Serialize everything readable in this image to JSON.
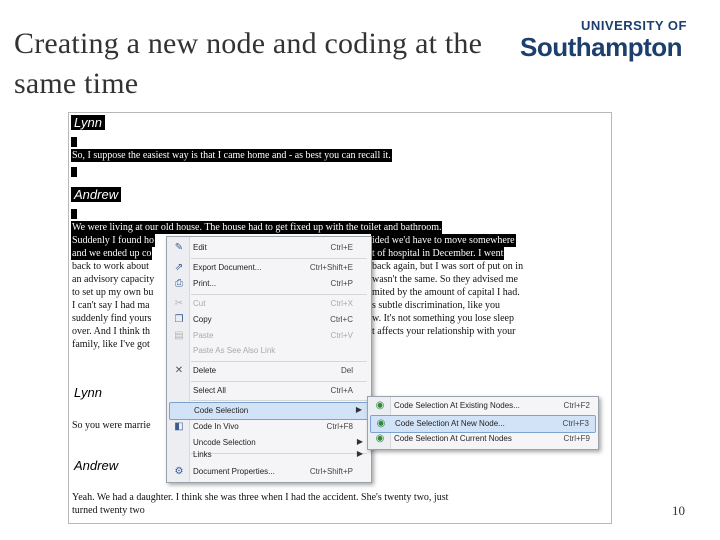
{
  "slide": {
    "title": "Creating a new node and coding at the same time",
    "logo_top": "UNIVERSITY OF",
    "logo_main": "Southampton",
    "page_number": "10"
  },
  "transcript": {
    "blocks": [
      {
        "speaker": "Lynn",
        "lines": [
          "So, I suppose the easiest way is that I came home and - as best you can recall it."
        ]
      },
      {
        "speaker": "Andrew",
        "lines": [
          "We were living at our old house. The house had to get fixed up with the toilet and bathroom.",
          "Suddenly I found ho",
          "and we ended up co",
          "back to work about",
          "an advisory capacity",
          "to set up my own bu",
          "I can't say I had ma",
          "suddenly find yours",
          "over. And I think th",
          "family, like I've got"
        ],
        "line_tails": [
          "",
          "ided we'd have to move somewhere",
          "t of hospital in December. I went",
          "back again, but I was sort of put on in",
          "wasn't the same. So they advised me",
          "mited by the amount of capital I had.",
          "s subtle discrimination, like you",
          "w. It's not something you lose sleep",
          "t affects your relationship with your",
          ""
        ]
      },
      {
        "speaker": "Lynn",
        "lines": [
          "So you were marrie"
        ]
      },
      {
        "speaker": "Andrew",
        "lines": [
          "Yeah. We had a daughter. I think she was three when I had the accident. She's twenty two, just",
          "turned twenty two"
        ]
      }
    ]
  },
  "context_menu": {
    "items": [
      {
        "label": "Edit",
        "shortcut": "Ctrl+E",
        "icon": "pencil-icon",
        "glyph": "✎",
        "enabled": true
      },
      {
        "label": "Export Document...",
        "shortcut": "Ctrl+Shift+E",
        "icon": "export-icon",
        "glyph": "⇗",
        "enabled": true
      },
      {
        "label": "Print...",
        "shortcut": "Ctrl+P",
        "icon": "print-icon",
        "glyph": "⎙",
        "enabled": true
      },
      {
        "label": "Cut",
        "shortcut": "Ctrl+X",
        "icon": "scissors-icon",
        "glyph": "✂",
        "enabled": false
      },
      {
        "label": "Copy",
        "shortcut": "Ctrl+C",
        "icon": "copy-icon",
        "glyph": "❐",
        "enabled": true
      },
      {
        "label": "Paste",
        "shortcut": "Ctrl+V",
        "icon": "paste-icon",
        "glyph": "▤",
        "enabled": false
      },
      {
        "label": "Paste As See Also Link",
        "shortcut": "",
        "icon": "",
        "glyph": "",
        "enabled": false
      },
      {
        "label": "Delete",
        "shortcut": "Del",
        "icon": "delete-icon",
        "glyph": "✕",
        "enabled": true
      },
      {
        "label": "Select All",
        "shortcut": "Ctrl+A",
        "icon": "",
        "glyph": "",
        "enabled": true
      },
      {
        "label": "Code Selection",
        "shortcut": "",
        "icon": "",
        "glyph": "",
        "enabled": true,
        "highlighted": true,
        "submenu": true
      },
      {
        "label": "Code In Vivo",
        "shortcut": "Ctrl+F8",
        "icon": "code-in-vivo-icon",
        "glyph": "◧",
        "enabled": true
      },
      {
        "label": "Uncode Selection",
        "shortcut": "",
        "icon": "",
        "glyph": "",
        "enabled": true,
        "submenu": true
      },
      {
        "label": "Links",
        "shortcut": "",
        "icon": "",
        "glyph": "",
        "enabled": true,
        "submenu": true
      },
      {
        "label": "Document Properties...",
        "shortcut": "Ctrl+Shift+P",
        "icon": "properties-icon",
        "glyph": "⚙",
        "enabled": true
      }
    ]
  },
  "submenu": {
    "items": [
      {
        "label": "Code Selection At Existing Nodes...",
        "shortcut": "Ctrl+F2",
        "icon": "code-existing-icon",
        "glyph": "◉",
        "enabled": true
      },
      {
        "label": "Code Selection At New Node...",
        "shortcut": "Ctrl+F3",
        "icon": "code-new-icon",
        "glyph": "◉",
        "enabled": true,
        "highlighted": true
      },
      {
        "label": "Code Selection At Current Nodes",
        "shortcut": "Ctrl+F9",
        "icon": "code-current-icon",
        "glyph": "◉",
        "enabled": true
      }
    ]
  }
}
